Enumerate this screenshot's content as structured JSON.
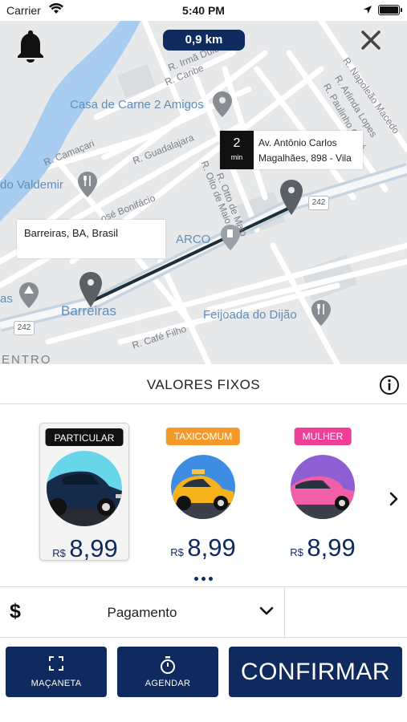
{
  "status_bar": {
    "carrier": "Carrier",
    "time": "5:40 PM"
  },
  "map": {
    "distance": "0,9 km",
    "streets": [
      "R. Irmã Dulce",
      "R. Caribe",
      "R. Guadalajara",
      "R. Camaçari",
      "R. Oito de Maio",
      "R. Otto de Maio",
      "R. Napoleão Macedo",
      "R. Arlinda Lopes",
      "R. Paulinho Coité",
      "osé Bonifácio",
      "R. Café Filho",
      "ENTRO",
      "as"
    ],
    "road_number": "242",
    "pois": [
      "Casa de Carne 2 Amigos",
      "do Valdemir",
      "ARCO",
      "Barreiras",
      "Feijoada do Dijão"
    ],
    "destination": {
      "minutes": "2",
      "unit": "min",
      "address": "Av. Antônio Carlos Magalhães, 898 - Vila"
    },
    "origin": {
      "address": "Barreiras, BA, Brasil"
    }
  },
  "values": {
    "title": "VALORES FIXOS",
    "options": [
      {
        "tag": "PARTICULAR",
        "tag_color": "#111111",
        "currency": "R$",
        "price": "8,99",
        "selected": true
      },
      {
        "tag": "TAXICOMUM",
        "tag_color": "#f39a2b",
        "currency": "R$",
        "price": "8,99",
        "selected": false
      },
      {
        "tag": "MULHER",
        "tag_color": "#ee3f96",
        "currency": "R$",
        "price": "8,99",
        "selected": false
      }
    ]
  },
  "payment": {
    "icon": "$",
    "label": "Pagamento"
  },
  "actions": {
    "macaneta": "MAÇANETA",
    "agendar": "AGENDAR",
    "confirm": "CONFIRMAR"
  },
  "colors": {
    "primary": "#0f2a5e",
    "price": "#0f2a5e",
    "poi": "#5f8fb8",
    "map_bg": "#e6e8ea"
  }
}
